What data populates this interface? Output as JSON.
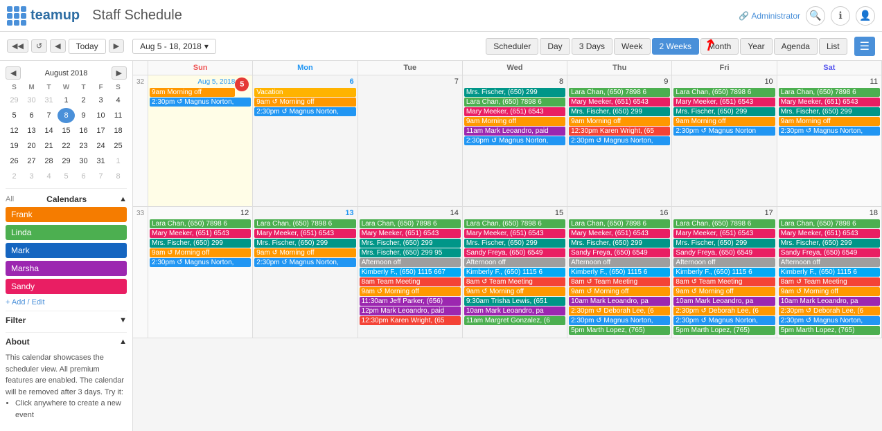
{
  "app": {
    "logo_text": "teamup",
    "title": "Staff Schedule",
    "admin_label": "Administrator"
  },
  "toolbar": {
    "month": "August",
    "year": "2018",
    "today_label": "Today",
    "date_range": "Aug 5 - 18, 2018",
    "views": [
      "Scheduler",
      "Day",
      "3 Days",
      "Week",
      "2 Weeks",
      "Month",
      "Year",
      "Agenda",
      "List"
    ],
    "active_view": "2 Weeks"
  },
  "sidebar": {
    "calendars_label": "Calendars",
    "all_label": "All",
    "calendars": [
      {
        "name": "Frank",
        "color": "#f57c00"
      },
      {
        "name": "Linda",
        "color": "#4caf50"
      },
      {
        "name": "Mark",
        "color": "#1565c0"
      },
      {
        "name": "Marsha",
        "color": "#9c27b0"
      },
      {
        "name": "Sandy",
        "color": "#e91e63"
      }
    ],
    "add_edit_label": "+ Add / Edit",
    "filter_label": "Filter",
    "about_label": "About",
    "about_text": "This calendar showcases the scheduler view. All premium features are enabled. The calendar will be removed after 3 days. Try it:",
    "about_bullets": [
      "Click anywhere to create a new event"
    ]
  },
  "mini_calendar": {
    "month": "August",
    "year": "2018",
    "days_header": [
      "S",
      "M",
      "T",
      "W",
      "T",
      "F",
      "S"
    ],
    "weeks": [
      [
        {
          "d": "29",
          "other": true
        },
        {
          "d": "30",
          "other": true
        },
        {
          "d": "31",
          "other": true
        },
        {
          "d": "1"
        },
        {
          "d": "2"
        },
        {
          "d": "3"
        },
        {
          "d": "4"
        }
      ],
      [
        {
          "d": "5"
        },
        {
          "d": "6"
        },
        {
          "d": "7"
        },
        {
          "d": "8",
          "today": true
        },
        {
          "d": "9"
        },
        {
          "d": "10"
        },
        {
          "d": "11"
        }
      ],
      [
        {
          "d": "12"
        },
        {
          "d": "13"
        },
        {
          "d": "14"
        },
        {
          "d": "15"
        },
        {
          "d": "16"
        },
        {
          "d": "17"
        },
        {
          "d": "18"
        }
      ],
      [
        {
          "d": "19"
        },
        {
          "d": "20"
        },
        {
          "d": "21"
        },
        {
          "d": "22"
        },
        {
          "d": "23"
        },
        {
          "d": "24"
        },
        {
          "d": "25"
        }
      ],
      [
        {
          "d": "26"
        },
        {
          "d": "27"
        },
        {
          "d": "28"
        },
        {
          "d": "29"
        },
        {
          "d": "30"
        },
        {
          "d": "31"
        },
        {
          "d": "1",
          "other": true
        }
      ],
      [
        {
          "d": "2",
          "other": true
        },
        {
          "d": "3",
          "other": true
        },
        {
          "d": "4",
          "other": true
        },
        {
          "d": "5",
          "other": true
        },
        {
          "d": "6",
          "other": true
        },
        {
          "d": "7",
          "other": true
        },
        {
          "d": "8",
          "other": true
        }
      ]
    ]
  },
  "calendar": {
    "day_headers": [
      "Sun",
      "Mon",
      "Tue",
      "Wed",
      "Thu",
      "Fri",
      "Sat"
    ],
    "week1": {
      "week_num": "32",
      "days": [
        {
          "num": "Aug 5, 2018",
          "num_short": "5",
          "is_highlighted": true,
          "events": [
            {
              "text": "9am Morning off",
              "color": "orange"
            },
            {
              "text": "2:30pm ↺ Magnus Norton,",
              "color": "blue"
            }
          ]
        },
        {
          "num": "6",
          "events": [
            {
              "text": "Vacation",
              "color": "vacation"
            },
            {
              "text": "9am ↺ Morning off",
              "color": "orange"
            },
            {
              "text": "2:30pm ↺ Magnus Norton,",
              "color": "blue"
            }
          ]
        },
        {
          "num": "7",
          "events": []
        },
        {
          "num": "8",
          "events": [
            {
              "text": "Mrs. Fischer, (650) 299",
              "color": "teal"
            },
            {
              "text": "Lara Chan, (650) 7898 6",
              "color": "green"
            },
            {
              "text": "Mary Meeker, (651) 6543",
              "color": "pink"
            },
            {
              "text": "9am Morning off",
              "color": "orange"
            },
            {
              "text": "11am Mark Leoandro, paid",
              "color": "purple"
            },
            {
              "text": "2:30pm ↺ Magnus Norton,",
              "color": "blue"
            }
          ]
        },
        {
          "num": "9",
          "events": [
            {
              "text": "Lara Chan, (650) 7898 6",
              "color": "green"
            },
            {
              "text": "Mary Meeker, (651) 6543",
              "color": "pink"
            },
            {
              "text": "Mrs. Fischer, (650) 299",
              "color": "teal"
            },
            {
              "text": "9am Morning off",
              "color": "orange"
            },
            {
              "text": "12:30pm Karen Wright, (65",
              "color": "red"
            },
            {
              "text": "2:30pm ↺ Magnus Norton,",
              "color": "blue"
            }
          ]
        },
        {
          "num": "10",
          "events": [
            {
              "text": "Lara Chan, (650) 7898 6",
              "color": "green"
            },
            {
              "text": "Mary Meeker, (651) 6543",
              "color": "pink"
            },
            {
              "text": "Mrs. Fischer, (650) 299",
              "color": "teal"
            },
            {
              "text": "9am Morning off",
              "color": "orange"
            },
            {
              "text": "2:30pm ↺ Magnus Norton",
              "color": "blue"
            }
          ]
        },
        {
          "num": "11",
          "events": [
            {
              "text": "Lara Chan, (650) 7898 6",
              "color": "green"
            },
            {
              "text": "Mary Meeker, (651) 6543",
              "color": "pink"
            },
            {
              "text": "Mrs. Fischer, (650) 299",
              "color": "teal"
            },
            {
              "text": "9am Morning off",
              "color": "orange"
            },
            {
              "text": "2:30pm ↺ Magnus Norton,",
              "color": "blue"
            }
          ]
        }
      ]
    },
    "week2": {
      "week_num": "33",
      "days": [
        {
          "num": "12",
          "events": [
            {
              "text": "Lara Chan, (650) 7898 6",
              "color": "green"
            },
            {
              "text": "Mary Meeker, (651) 6543",
              "color": "pink"
            },
            {
              "text": "Mrs. Fischer, (650) 299",
              "color": "teal"
            },
            {
              "text": "9am ↺ Morning off",
              "color": "orange"
            },
            {
              "text": "2:30pm ↺ Magnus Norton,",
              "color": "blue"
            }
          ]
        },
        {
          "num": "13",
          "events": [
            {
              "text": "Lara Chan, (650) 7898 6",
              "color": "green"
            },
            {
              "text": "Mary Meeker, (651) 6543",
              "color": "pink"
            },
            {
              "text": "Mrs. Fischer, (650) 299",
              "color": "teal"
            },
            {
              "text": "9am ↺ Morning off",
              "color": "orange"
            },
            {
              "text": "2:30pm ↺ Magnus Norton,",
              "color": "blue"
            }
          ]
        },
        {
          "num": "14",
          "events": [
            {
              "text": "Lara Chan, (650) 7898 6",
              "color": "green"
            },
            {
              "text": "Mary Meeker, (651) 6543",
              "color": "pink"
            },
            {
              "text": "Mrs. Fischer, (650) 299",
              "color": "teal"
            },
            {
              "text": "Mrs. Fischer, (650) 299 95",
              "color": "teal"
            },
            {
              "text": "Afternoon off",
              "color": "gray"
            },
            {
              "text": "Kimberly F., (650) 1115 667",
              "color": "light-blue"
            },
            {
              "text": "8am Team Meeting",
              "color": "red"
            },
            {
              "text": "9am ↺ Morning off",
              "color": "orange"
            },
            {
              "text": "11:30am Jeff Parker, (656)",
              "color": "purple"
            },
            {
              "text": "12pm Mark Leoandro, paid",
              "color": "purple"
            },
            {
              "text": "12:30pm Karen Wright, (65",
              "color": "red"
            }
          ]
        },
        {
          "num": "15",
          "events": [
            {
              "text": "Lara Chan, (650) 7898 6",
              "color": "green"
            },
            {
              "text": "Mary Meeker, (651) 6543",
              "color": "pink"
            },
            {
              "text": "Mrs. Fischer, (650) 299",
              "color": "teal"
            },
            {
              "text": "Sandy Freya, (650) 6549",
              "color": "pink"
            },
            {
              "text": "Afternoon off",
              "color": "gray"
            },
            {
              "text": "Kimberly F., (650) 1115 6",
              "color": "light-blue"
            },
            {
              "text": "8am ↺ Team Meeting",
              "color": "red"
            },
            {
              "text": "9am ↺ Morning off",
              "color": "orange"
            },
            {
              "text": "9:30am Trisha Lewis, (651",
              "color": "teal"
            },
            {
              "text": "10am Mark Leoandro, pa",
              "color": "purple"
            },
            {
              "text": "11am Margret Gonzalez, (6",
              "color": "green"
            }
          ]
        },
        {
          "num": "16",
          "events": [
            {
              "text": "Lara Chan, (650) 7898 6",
              "color": "green"
            },
            {
              "text": "Mary Meeker, (651) 6543",
              "color": "pink"
            },
            {
              "text": "Mrs. Fischer, (650) 299",
              "color": "teal"
            },
            {
              "text": "Sandy Freya, (650) 6549",
              "color": "pink"
            },
            {
              "text": "Afternoon off",
              "color": "gray"
            },
            {
              "text": "Kimberly F., (650) 1115 6",
              "color": "light-blue"
            },
            {
              "text": "8am ↺ Team Meeting",
              "color": "red"
            },
            {
              "text": "9am ↺ Morning off",
              "color": "orange"
            },
            {
              "text": "10am Mark Leoandro, pa",
              "color": "purple"
            },
            {
              "text": "2:30pm ↺ Deborah Lee, (6",
              "color": "orange"
            },
            {
              "text": "2:30pm ↺ Magnus Norton,",
              "color": "blue"
            },
            {
              "text": "5pm Marth Lopez, (765)",
              "color": "green"
            }
          ]
        },
        {
          "num": "17",
          "events": [
            {
              "text": "Lara Chan, (650) 7898 6",
              "color": "green"
            },
            {
              "text": "Mary Meeker, (651) 6543",
              "color": "pink"
            },
            {
              "text": "Mrs. Fischer, (650) 299",
              "color": "teal"
            },
            {
              "text": "Sandy Freya, (650) 6549",
              "color": "pink"
            },
            {
              "text": "Afternoon off",
              "color": "gray"
            },
            {
              "text": "Kimberly F., (650) 1115 6",
              "color": "light-blue"
            },
            {
              "text": "8am ↺ Team Meeting",
              "color": "red"
            },
            {
              "text": "9am ↺ Morning off",
              "color": "orange"
            },
            {
              "text": "10am Mark Leoandro, pa",
              "color": "purple"
            },
            {
              "text": "2:30pm ↺ Deborah Lee, (6",
              "color": "orange"
            },
            {
              "text": "2:30pm ↺ Magnus Norton,",
              "color": "blue"
            },
            {
              "text": "5pm Marth Lopez, (765)",
              "color": "green"
            }
          ]
        },
        {
          "num": "18",
          "events": [
            {
              "text": "Lara Chan, (650) 7898 6",
              "color": "green"
            },
            {
              "text": "Mary Meeker, (651) 6543",
              "color": "pink"
            },
            {
              "text": "Mrs. Fischer, (650) 299",
              "color": "teal"
            },
            {
              "text": "Sandy Freya, (650) 6549",
              "color": "pink"
            },
            {
              "text": "Afternoon off",
              "color": "gray"
            },
            {
              "text": "Kimberly F., (650) 1115 6",
              "color": "light-blue"
            },
            {
              "text": "8am ↺ Team Meeting",
              "color": "red"
            },
            {
              "text": "9am ↺ Morning off",
              "color": "orange"
            },
            {
              "text": "10am Mark Leoandro, pa",
              "color": "purple"
            },
            {
              "text": "2:30pm ↺ Deborah Lee, (6",
              "color": "orange"
            },
            {
              "text": "2:30pm ↺ Magnus Norton,",
              "color": "blue"
            },
            {
              "text": "5pm Marth Lopez, (765)",
              "color": "green"
            }
          ]
        }
      ]
    }
  }
}
